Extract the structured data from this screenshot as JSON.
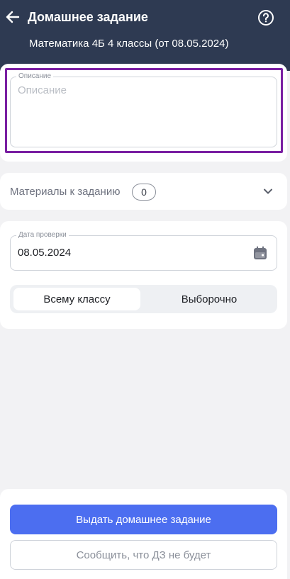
{
  "header": {
    "title": "Домашнее задание",
    "subtitle": "Математика 4Б 4 классы (от 08.05.2024)",
    "back_icon": "arrow-left-icon",
    "help_icon": "question-circle-icon"
  },
  "description": {
    "legend": "Описание",
    "placeholder": "Описание",
    "value": ""
  },
  "materials": {
    "label": "Материалы к заданию",
    "count": "0",
    "expand_icon": "chevron-down-icon"
  },
  "check_date": {
    "legend": "Дата проверки",
    "value": "08.05.2024",
    "icon": "calendar-icon"
  },
  "assign_mode": {
    "options": [
      "Всему классу",
      "Выборочно"
    ],
    "selected": "Всему классу"
  },
  "actions": {
    "primary_label": "Выдать домашнее задание",
    "secondary_label": "Сообщить, что ДЗ не будет"
  },
  "colors": {
    "header_bg": "#2e3a52",
    "accent": "#4c6ef0",
    "highlight": "#7a1fa2"
  }
}
